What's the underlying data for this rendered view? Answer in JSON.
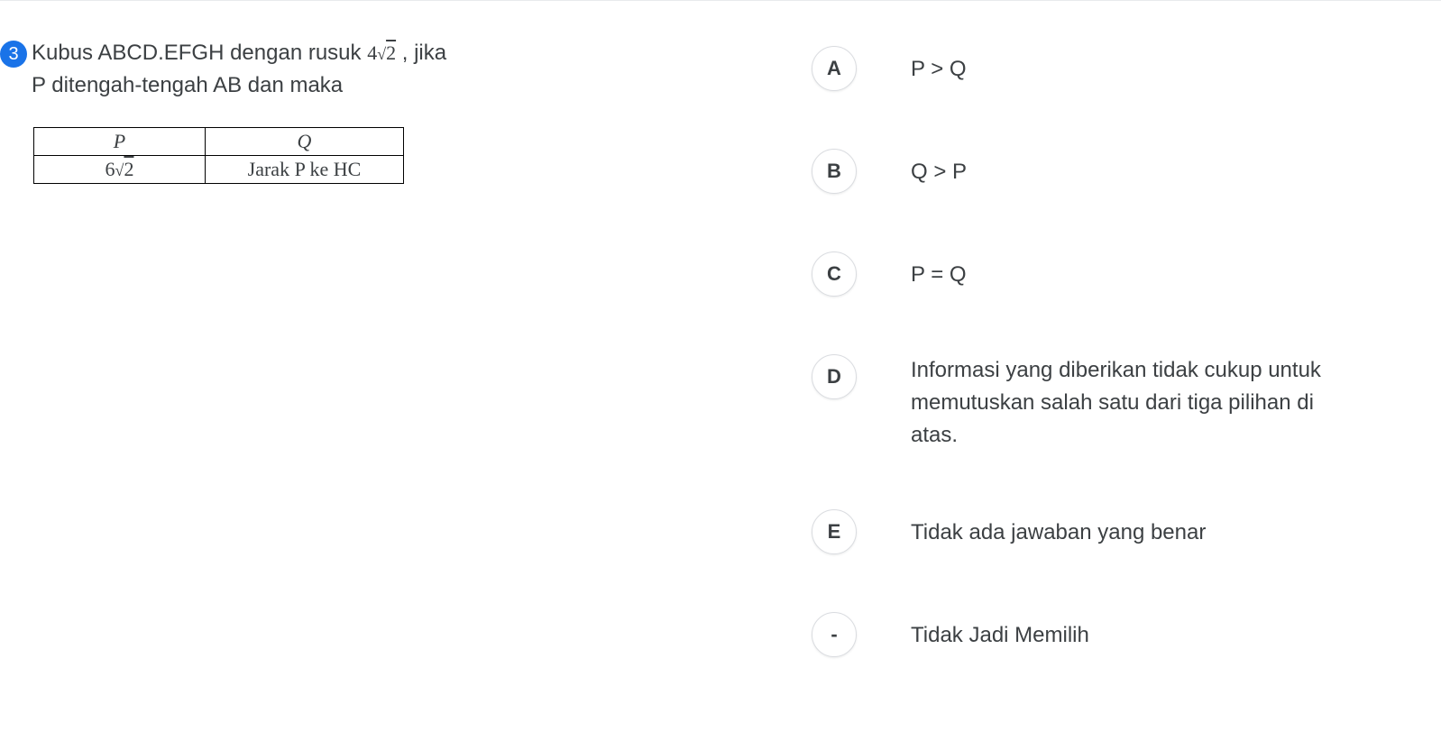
{
  "question": {
    "number": "3",
    "text_part1": "Kubus ABCD.EFGH dengan rusuk ",
    "math_expr": "4√2",
    "text_part2": " , jika",
    "text_line2": "P ditengah-tengah AB dan maka"
  },
  "table": {
    "header_p": "P",
    "header_q": "Q",
    "value_p": "6√2",
    "value_q": "Jarak P ke HC"
  },
  "options": [
    {
      "letter": "A",
      "text": "P > Q"
    },
    {
      "letter": "B",
      "text": "Q > P"
    },
    {
      "letter": "C",
      "text": "P = Q"
    },
    {
      "letter": "D",
      "text": "Informasi yang diberikan tidak cukup untuk memutuskan salah satu dari tiga pilihan di atas."
    },
    {
      "letter": "E",
      "text": "Tidak ada jawaban yang benar"
    },
    {
      "letter": "-",
      "text": "Tidak Jadi Memilih"
    }
  ]
}
